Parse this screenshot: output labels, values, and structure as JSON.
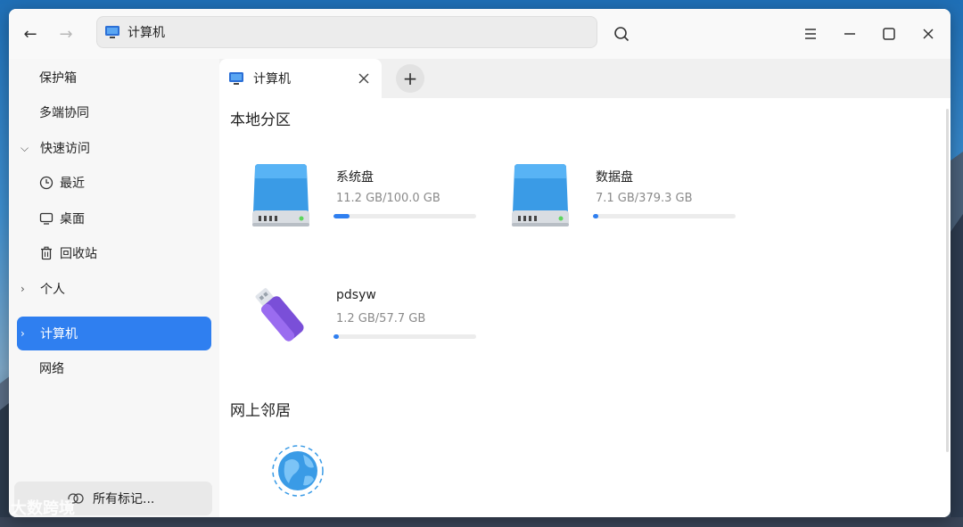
{
  "titlebar": {
    "address": "计算机",
    "back_icon": "arrow-left-icon",
    "forward_icon": "arrow-right-icon",
    "search_icon": "search-icon",
    "menu_icon": "hamburger-menu-icon",
    "minimize_icon": "minimize-icon",
    "maximize_icon": "maximize-icon",
    "close_icon": "close-icon"
  },
  "sidebar": {
    "items": [
      {
        "label": "保护箱"
      },
      {
        "label": "多端协同"
      },
      {
        "label": "快速访问"
      },
      {
        "label": "最近"
      },
      {
        "label": "桌面"
      },
      {
        "label": "回收站"
      },
      {
        "label": "个人"
      },
      {
        "label": "计算机"
      },
      {
        "label": "网络"
      }
    ],
    "tags_label": "所有标记..."
  },
  "tabs": [
    {
      "label": "计算机"
    }
  ],
  "content": {
    "local_title": "本地分区",
    "network_title": "网上邻居",
    "disks": [
      {
        "name": "系统盘",
        "size": "11.2 GB/100.0 GB",
        "usage": 0.112
      },
      {
        "name": "数据盘",
        "size": "7.1 GB/379.3 GB",
        "usage": 0.019
      },
      {
        "name": "pdsyw",
        "size": "1.2 GB/57.7 GB",
        "usage": 0.021
      }
    ]
  },
  "colors": {
    "accent": "#2f7ff0",
    "disk_blue": "#3a9be6"
  },
  "watermark": "大数跨境"
}
